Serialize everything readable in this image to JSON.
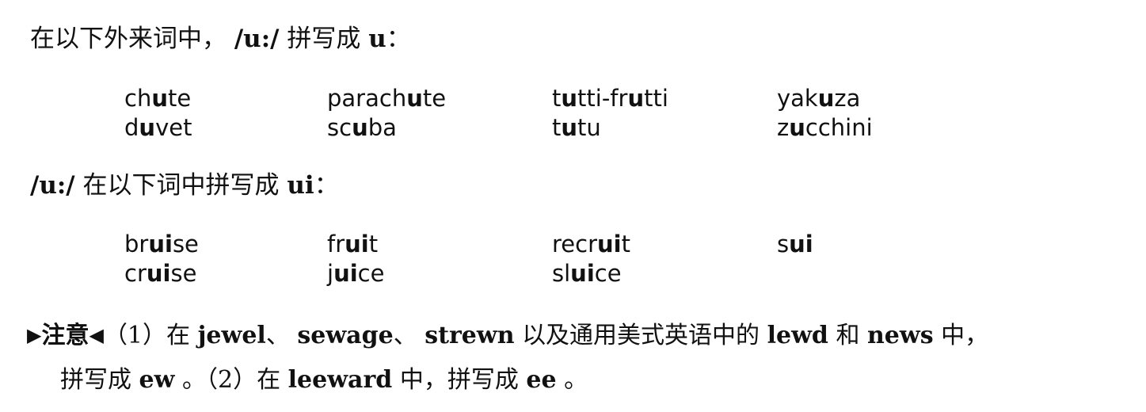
{
  "section1": {
    "intro": "在以下外来词中，",
    "phoneme": "/u:/",
    "verb": "拼写成",
    "spelling": "u",
    "colon": "："
  },
  "section1_words": [
    [
      {
        "pre": "ch",
        "bold": "u",
        "post": "te"
      },
      {
        "pre": "parach",
        "bold": "u",
        "post": "te"
      },
      {
        "pre": "t",
        "bold": "u",
        "post": "tti-fr",
        "bold2": "u",
        "post2": "tti"
      },
      {
        "pre": "yak",
        "bold": "u",
        "post": "za"
      }
    ],
    [
      {
        "pre": "d",
        "bold": "u",
        "post": "vet"
      },
      {
        "pre": "sc",
        "bold": "u",
        "post": "ba"
      },
      {
        "pre": "t",
        "bold": "u",
        "post": "tu"
      },
      {
        "pre": "z",
        "bold": "u",
        "post": "cchini"
      }
    ]
  ],
  "section2": {
    "phoneme": "/u:/",
    "text": "在以下词中拼写成",
    "spelling": "ui",
    "colon": "："
  },
  "section2_words": [
    [
      {
        "pre": "br",
        "bold": "ui",
        "post": "se"
      },
      {
        "pre": "fr",
        "bold": "ui",
        "post": "t"
      },
      {
        "pre": "recr",
        "bold": "ui",
        "post": "t"
      },
      {
        "pre": "s",
        "bold": "ui",
        "post": ""
      }
    ],
    [
      {
        "pre": "cr",
        "bold": "ui",
        "post": "se"
      },
      {
        "pre": "j",
        "bold": "ui",
        "post": "ce"
      },
      {
        "pre": "sl",
        "bold": "ui",
        "post": "ce"
      }
    ]
  ],
  "note": {
    "arrow_right": "▶",
    "label": "注意",
    "arrow_left": "◀",
    "p1_num": "（1）",
    "p1_a": "在",
    "w1": "jewel",
    "sep1": "、",
    "w2": "sewage",
    "sep2": "、",
    "w3": "strewn",
    "p1_b": "以及通用美式英语中的",
    "w4": "lewd",
    "p1_c": "和",
    "w5": "news",
    "p1_d": "中，",
    "p1_e": "拼写成",
    "w6": "ew",
    "p1_end": "。",
    "p2_num": "（2）",
    "p2_a": "在",
    "w7": "leeward",
    "p2_b": "中，拼写成",
    "w8": "ee",
    "p2_end": "。"
  }
}
